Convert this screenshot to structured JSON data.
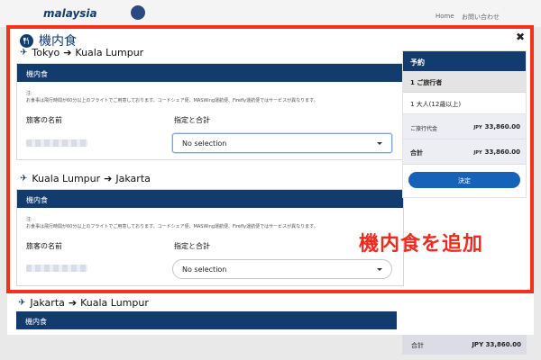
{
  "background": {
    "logo_text": "malaysia",
    "nav": {
      "home": "Home",
      "contact": "お問い合わせ"
    },
    "total_label": "合計",
    "total_currency": "JPY",
    "total_amount": "33,860.00"
  },
  "modal": {
    "title": "機内食",
    "close_glyph": "✖",
    "segments": [
      {
        "from": "Tokyo",
        "to": "Kuala Lumpur",
        "meal_header": "機内食",
        "note_prefix": "注:",
        "note": "お食事は飛行時間が60分以上のフライトでご用意しております。コードシェア便、MASWing運航便、Firefly運航便ではサービスが異なります。",
        "passenger_label": "旅客の名前",
        "select_label": "指定と合計",
        "select_value": "No selection"
      },
      {
        "from": "Kuala Lumpur",
        "to": "Jakarta",
        "meal_header": "機内食",
        "note_prefix": "注:",
        "note": "お食事は飛行時間が60分以上のフライトでご用意しております。コードシェア便、MASWing運航便、Firefly運航便ではサービスが異なります。",
        "passenger_label": "旅客の名前",
        "select_label": "指定と合計",
        "select_value": "No selection"
      },
      {
        "from": "Jakarta",
        "to": "Kuala Lumpur",
        "meal_header": "機内食"
      }
    ]
  },
  "sidebar": {
    "title": "予約",
    "passengers_header": "1 ご旅行者",
    "passenger_value": "1 大人(12歳以上)",
    "fare_label": "ご旅行代金",
    "fare_currency": "JPY",
    "fare_amount": "33,860.00",
    "total_label": "合計",
    "total_currency": "JPY",
    "total_amount": "33,860.00",
    "confirm_button": "決定"
  },
  "annotation": {
    "callout": "機内食を追加",
    "color": "#f2321f"
  },
  "colors": {
    "brand_navy": "#123b6e",
    "button_blue": "#1662b8"
  }
}
